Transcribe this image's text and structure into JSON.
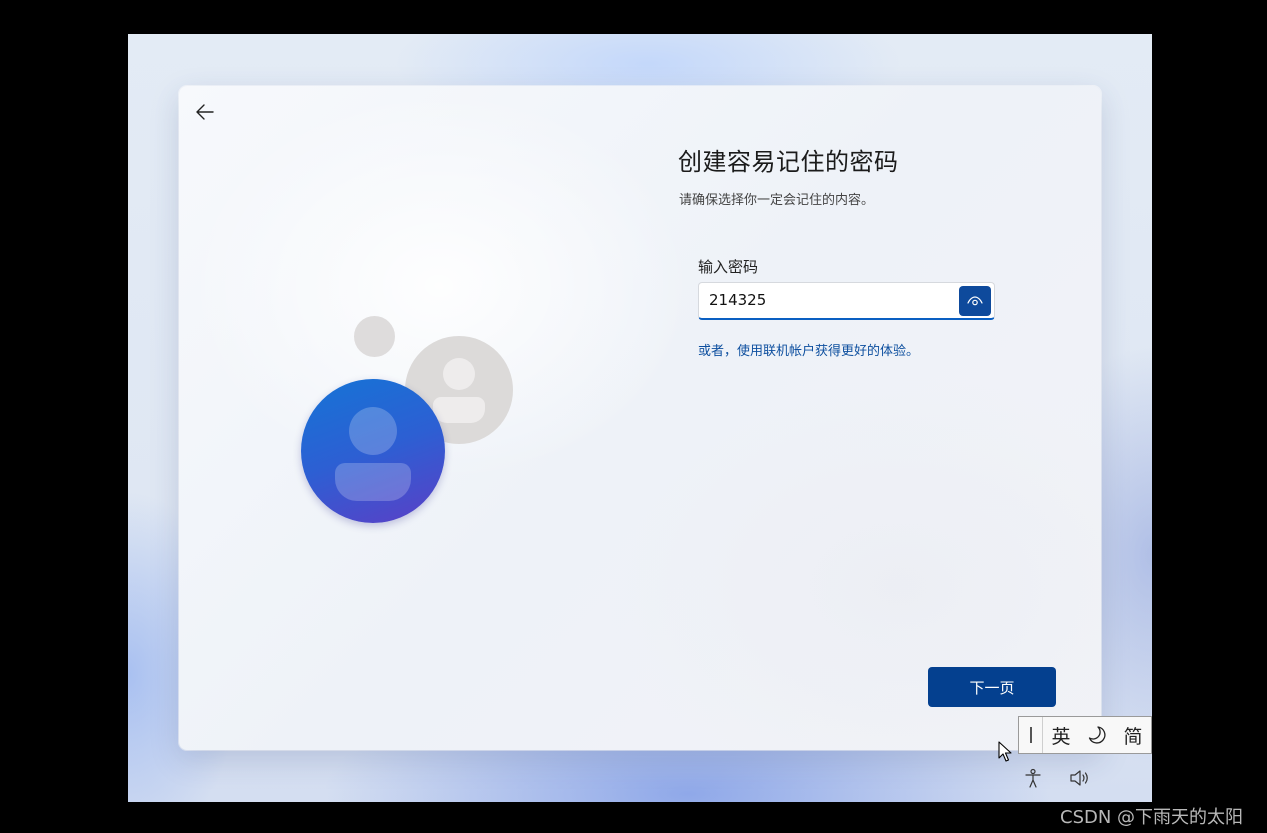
{
  "oobe": {
    "title": "创建容易记住的密码",
    "subtitle": "请确保选择你一定会记住的内容。",
    "password_label": "输入密码",
    "password_value": "214325",
    "alt_link": "或者，使用联机帐户获得更好的体验。",
    "next_label": "下一页"
  },
  "ime": {
    "mode_label": "英",
    "punct_symbol": "☽",
    "script_label": "简"
  },
  "icons": [
    "back-arrow-icon",
    "eye-icon",
    "accessibility-icon",
    "volume-icon",
    "mouse-cursor-icon"
  ],
  "colors": {
    "accent": "#04408f",
    "link": "#0d4f9f",
    "avatar_gradient_start": "#1574d6",
    "avatar_gradient_end": "#5b3fc6"
  },
  "watermark": "CSDN @下雨天的太阳"
}
